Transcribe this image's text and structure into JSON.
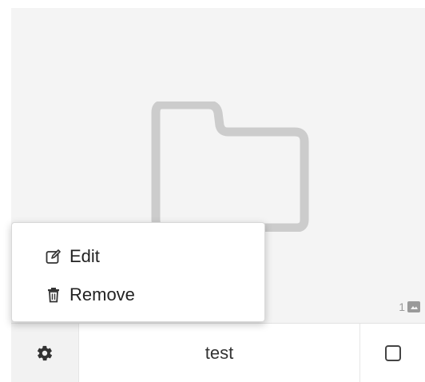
{
  "colors": {
    "thumb_background": "#f4f4f4",
    "folder_stroke": "#cccccc",
    "menu_text": "#222222",
    "badge_text": "#9a9a9a"
  },
  "thumbnail": {
    "icon": "folder-icon",
    "count": "1",
    "count_icon": "image-icon"
  },
  "context_menu": {
    "items": [
      {
        "label": "Edit",
        "icon": "edit-icon"
      },
      {
        "label": "Remove",
        "icon": "trash-icon"
      }
    ]
  },
  "bottom_bar": {
    "settings_icon": "gear-icon",
    "name": "test",
    "checkbox_checked": false
  }
}
